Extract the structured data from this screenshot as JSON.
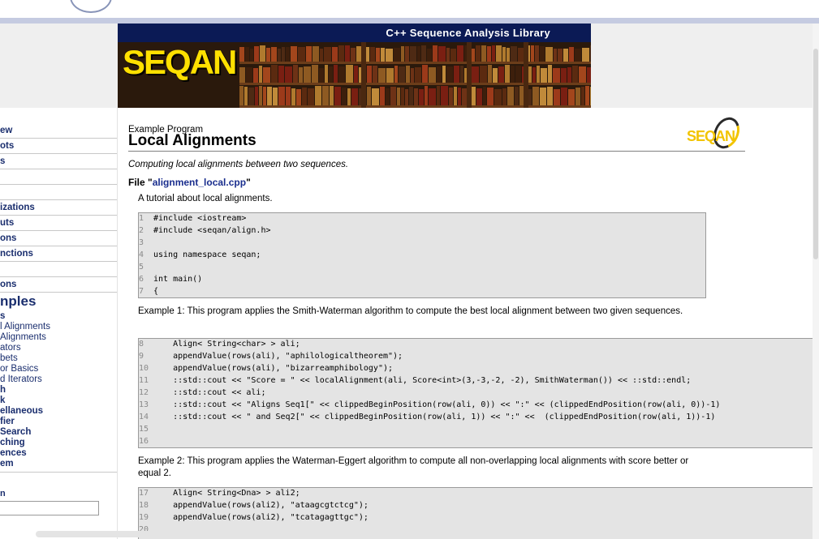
{
  "banner": {
    "title": "C++ Sequence Analysis Library",
    "logo_text": "SEQAN"
  },
  "sidebar": {
    "nav_items": [
      "ew",
      "ots",
      "s",
      "",
      "",
      "izations",
      "uts",
      "ons",
      "nctions",
      "",
      "ons"
    ],
    "examples_heading": "nples",
    "sub_items": [
      {
        "label": "s",
        "bold": true
      },
      {
        "label": "l Alignments",
        "bold": false
      },
      {
        "label": "Alignments",
        "bold": false
      },
      {
        "label": "ators",
        "bold": false
      },
      {
        "label": "bets",
        "bold": false
      },
      {
        "label": "or Basics",
        "bold": false
      },
      {
        "label": "d Iterators",
        "bold": false
      },
      {
        "label": "h",
        "bold": true
      },
      {
        "label": "k",
        "bold": true
      },
      {
        "label": "ellaneous",
        "bold": true
      },
      {
        "label": "fier",
        "bold": true
      },
      {
        "label": "Search",
        "bold": true
      },
      {
        "label": "ching",
        "bold": true
      },
      {
        "label": "ences",
        "bold": true
      },
      {
        "label": "em",
        "bold": true
      }
    ],
    "search_label": "n",
    "search_value": ""
  },
  "doc": {
    "subtitle": "Example Program",
    "title": "Local Alignments",
    "corner_logo": "SEQAN",
    "description": "Computing local alignments between two sequences.",
    "file_prefix": "File \"",
    "file_name": "alignment_local.cpp",
    "file_suffix": "\"",
    "tutorial": "A tutorial about local alignments.",
    "code1": [
      {
        "n": "1",
        "t": "#include <iostream>"
      },
      {
        "n": "2",
        "t": "#include <seqan/align.h>"
      },
      {
        "n": "3",
        "t": ""
      },
      {
        "n": "4",
        "t": "using namespace seqan;"
      },
      {
        "n": "5",
        "t": ""
      },
      {
        "n": "6",
        "t": "int main()"
      },
      {
        "n": "7",
        "t": "{"
      }
    ],
    "example1": "Example 1: This program applies the Smith-Waterman algorithm to compute the best local alignment between two given sequences.",
    "code2": [
      {
        "n": "8",
        "t": "    Align< String<char> > ali;"
      },
      {
        "n": "9",
        "t": "    appendValue(rows(ali), \"aphilologicaltheorem\");"
      },
      {
        "n": "10",
        "t": "    appendValue(rows(ali), \"bizarreamphibology\");"
      },
      {
        "n": "11",
        "t": "    ::std::cout << \"Score = \" << localAlignment(ali, Score<int>(3,-3,-2, -2), SmithWaterman()) << ::std::endl;"
      },
      {
        "n": "12",
        "t": "    ::std::cout << ali;"
      },
      {
        "n": "13",
        "t": "    ::std::cout << \"Aligns Seq1[\" << clippedBeginPosition(row(ali, 0)) << \":\" << (clippedEndPosition(row(ali, 0))-1)"
      },
      {
        "n": "14",
        "t": "    ::std::cout << \" and Seq2[\" << clippedBeginPosition(row(ali, 1)) << \":\" <<  (clippedEndPosition(row(ali, 1))-1)"
      },
      {
        "n": "15",
        "t": ""
      },
      {
        "n": "16",
        "t": ""
      }
    ],
    "example2": "Example 2: This program applies the Waterman-Eggert algorithm to compute all non-overlapping local alignments with score better or equal 2.",
    "code3": [
      {
        "n": "17",
        "t": "    Align< String<Dna> > ali2;"
      },
      {
        "n": "18",
        "t": "    appendValue(rows(ali2), \"ataagcgtctcg\");"
      },
      {
        "n": "19",
        "t": "    appendValue(rows(ali2), \"tcatagagttgc\");"
      },
      {
        "n": "20",
        "t": ""
      }
    ]
  },
  "colors": {
    "link": "#1a2e8e",
    "nav_text": "#1a2e6e",
    "banner_bar": "#0b1a55",
    "code_bg": "#e4e4e4",
    "logo_yellow": "#ffe000"
  }
}
